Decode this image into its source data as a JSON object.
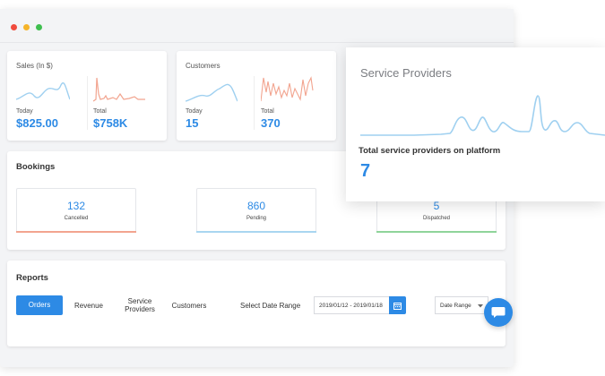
{
  "window": {
    "dots": [
      "#f04b3d",
      "#f5b42a",
      "#3fbf4f"
    ]
  },
  "stats": {
    "sales": {
      "title": "Sales (In $)",
      "today_label": "Today",
      "today_value": "$825.00",
      "total_label": "Total",
      "total_value": "$758K"
    },
    "customers": {
      "title": "Customers",
      "today_label": "Today",
      "today_value": "15",
      "total_label": "Total",
      "total_value": "370"
    }
  },
  "bookings": {
    "title": "Bookings",
    "items": [
      {
        "value": "132",
        "label": "Cancelled",
        "color": "#f2a48f"
      },
      {
        "value": "860",
        "label": "Pending",
        "color": "#a9d6f0"
      },
      {
        "value": "5",
        "label": "Dispatched",
        "color": "#8fd49a"
      }
    ]
  },
  "reports": {
    "title": "Reports",
    "tabs": [
      "Orders",
      "Revenue",
      "Service Providers",
      "Customers"
    ],
    "date_range_label": "Select Date Range",
    "date_range_value": "2019/01/12 - 2019/01/18",
    "select_value": "Date Range"
  },
  "popup": {
    "title": "Service Providers",
    "subtitle": "Total service providers on platform",
    "value": "7"
  },
  "colors": {
    "accent": "#2d8ae5",
    "line_blue": "#9fd0f0",
    "line_red": "#f2a48f"
  }
}
